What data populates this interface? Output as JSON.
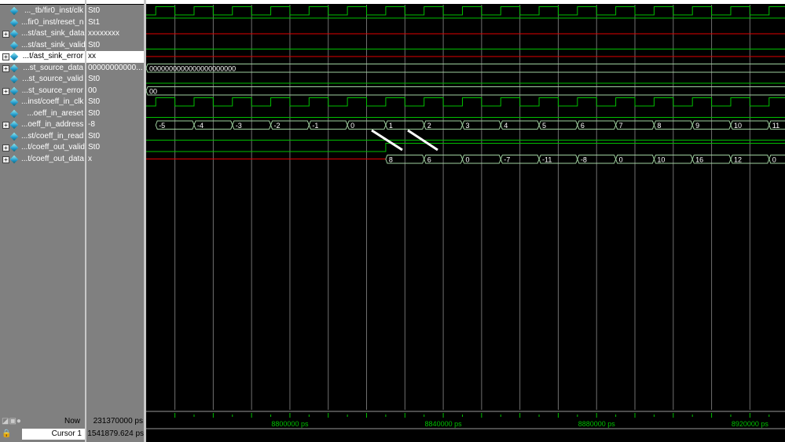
{
  "signals": [
    {
      "name": "..._tb/fir0_inst/clk",
      "value": "St0",
      "kind": "clock",
      "expandable": false
    },
    {
      "name": "...fir0_inst/reset_n",
      "value": "St1",
      "kind": "high",
      "expandable": false
    },
    {
      "name": "...st/ast_sink_data",
      "value": "xxxxxxxx",
      "kind": "x",
      "expandable": true
    },
    {
      "name": "...st/ast_sink_valid",
      "value": "St0",
      "kind": "low",
      "expandable": false
    },
    {
      "name": "...t/ast_sink_error",
      "value": "xx",
      "kind": "x",
      "expandable": true,
      "selected": true
    },
    {
      "name": "...st_source_data",
      "value": "00000000000...",
      "kind": "bus",
      "expandable": true,
      "bus": [
        {
          "t": 8762500,
          "v": "0000000000000000000000"
        }
      ]
    },
    {
      "name": "...st_source_valid",
      "value": "St0",
      "kind": "low",
      "expandable": false
    },
    {
      "name": "...st_source_error",
      "value": "00",
      "kind": "bus",
      "expandable": true,
      "bus": [
        {
          "t": 8762500,
          "v": "00"
        }
      ]
    },
    {
      "name": "...inst/coeff_in_clk",
      "value": "St0",
      "kind": "clock",
      "expandable": false
    },
    {
      "name": "...oeff_in_areset",
      "value": "St0",
      "kind": "low",
      "expandable": false
    },
    {
      "name": "...oeff_in_address",
      "value": "-8",
      "kind": "bus",
      "expandable": true,
      "bus": [
        {
          "t": 8765000,
          "v": "-5"
        },
        {
          "t": 8775000,
          "v": "-4"
        },
        {
          "t": 8785000,
          "v": "-3"
        },
        {
          "t": 8795000,
          "v": "-2"
        },
        {
          "t": 8805000,
          "v": "-1"
        },
        {
          "t": 8815000,
          "v": "0"
        },
        {
          "t": 8825000,
          "v": "1"
        },
        {
          "t": 8835000,
          "v": "2"
        },
        {
          "t": 8845000,
          "v": "3"
        },
        {
          "t": 8855000,
          "v": "4"
        },
        {
          "t": 8865000,
          "v": "5"
        },
        {
          "t": 8875000,
          "v": "6"
        },
        {
          "t": 8885000,
          "v": "7"
        },
        {
          "t": 8895000,
          "v": "8"
        },
        {
          "t": 8905000,
          "v": "9"
        },
        {
          "t": 8915000,
          "v": "10"
        },
        {
          "t": 8925000,
          "v": "11"
        }
      ]
    },
    {
      "name": "...st/coeff_in_read",
      "value": "St0",
      "kind": "low",
      "expandable": false
    },
    {
      "name": "...t/coeff_out_valid",
      "value": "St0",
      "kind": "step",
      "expandable": true,
      "rise": 8825000
    },
    {
      "name": "...t/coeff_out_data",
      "value": "x",
      "kind": "xbus",
      "expandable": true,
      "start": 8825000,
      "bus": [
        {
          "t": 8825000,
          "v": "8"
        },
        {
          "t": 8835000,
          "v": "6"
        },
        {
          "t": 8845000,
          "v": "0"
        },
        {
          "t": 8855000,
          "v": "-7"
        },
        {
          "t": 8865000,
          "v": "-11"
        },
        {
          "t": 8875000,
          "v": "-8"
        },
        {
          "t": 8885000,
          "v": "0"
        },
        {
          "t": 8895000,
          "v": "10"
        },
        {
          "t": 8905000,
          "v": "16"
        },
        {
          "t": 8915000,
          "v": "12"
        },
        {
          "t": 8925000,
          "v": "0"
        }
      ]
    }
  ],
  "time": {
    "start": 8762500,
    "end": 8929150,
    "clock_period": 10000,
    "first_rise": 8765000,
    "grid_step": 10000
  },
  "ruler": {
    "labels": [
      {
        "t": 8800000,
        "text": "8800000 ps"
      },
      {
        "t": 8840000,
        "text": "8840000 ps"
      },
      {
        "t": 8880000,
        "text": "8880000 ps"
      },
      {
        "t": 8920000,
        "text": "8920000 ps"
      }
    ]
  },
  "footer": {
    "now_label": "Now",
    "now_value": "231370000 ps",
    "cursor_label": "Cursor 1",
    "cursor_value": "1541879.624 ps"
  },
  "colors": {
    "signal": "#00c000",
    "x": "#e00000",
    "bus": "#9fd09f",
    "grid": "#707070"
  }
}
